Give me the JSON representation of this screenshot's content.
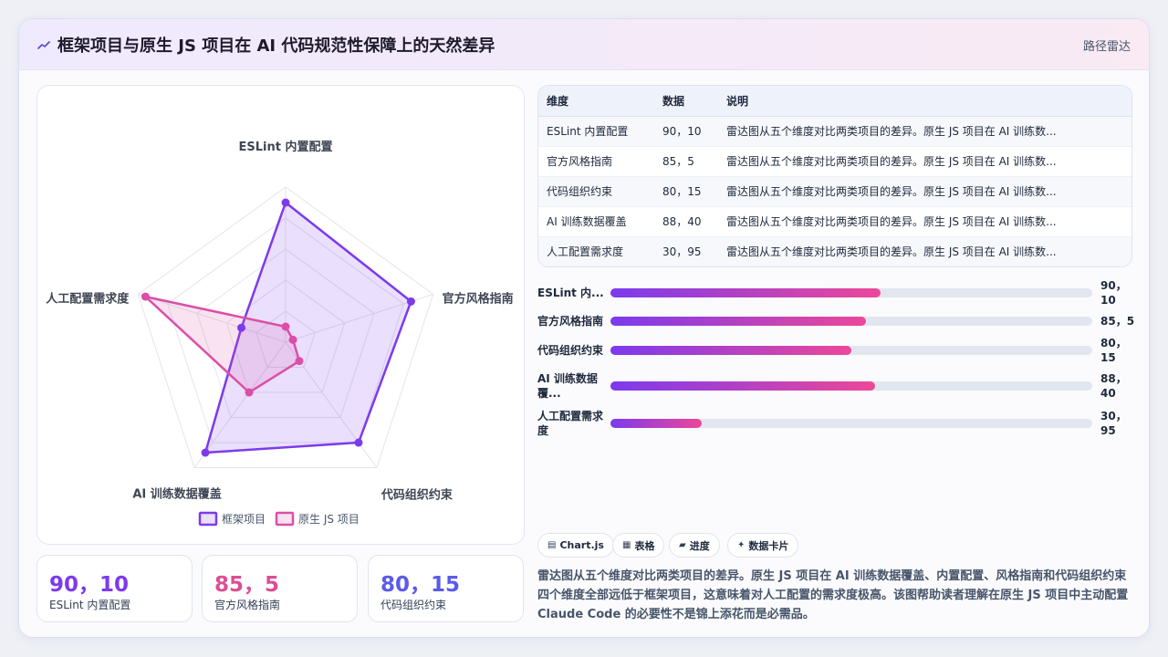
{
  "header": {
    "icon": "chart-line-icon",
    "title": "框架项目与原生 JS 项目在 AI 代码规范性保障上的天然差异",
    "right_label": "路径雷达"
  },
  "colors": {
    "framework": "#7c3aed",
    "native": "#db4fa7",
    "kpi1": "#7c3aed",
    "kpi2": "#db4f94",
    "kpi3": "#5b5be8"
  },
  "chart_data": {
    "type": "radar",
    "axes": [
      "ESLint 内置配置",
      "官方风格指南",
      "代码组织约束",
      "AI 训练数据覆盖",
      "人工配置需求度"
    ],
    "series": [
      {
        "name": "框架项目",
        "values": [
          90,
          85,
          80,
          88,
          30
        ]
      },
      {
        "name": "原生 JS 项目",
        "values": [
          10,
          5,
          15,
          40,
          95
        ]
      }
    ],
    "range": [
      0,
      100
    ],
    "grid_levels": 5,
    "legend_position": "bottom"
  },
  "legend": [
    {
      "label": "框架项目"
    },
    {
      "label": "原生 JS 项目"
    }
  ],
  "kpis": [
    {
      "value": "90，10",
      "label": "ESLint 内置配置"
    },
    {
      "value": "85，5",
      "label": "官方风格指南"
    },
    {
      "value": "80，15",
      "label": "代码组织约束"
    }
  ],
  "table": {
    "headers": [
      "维度",
      "数据",
      "说明"
    ],
    "rows": [
      {
        "dim": "ESLint 内置配置",
        "data": "90，10",
        "desc": "雷达图从五个维度对比两类项目的差异。原生 JS 项目在 AI 训练数..."
      },
      {
        "dim": "官方风格指南",
        "data": "85，5",
        "desc": "雷达图从五个维度对比两类项目的差异。原生 JS 项目在 AI 训练数..."
      },
      {
        "dim": "代码组织约束",
        "data": "80，15",
        "desc": "雷达图从五个维度对比两类项目的差异。原生 JS 项目在 AI 训练数..."
      },
      {
        "dim": "AI 训练数据覆盖",
        "data": "88，40",
        "desc": "雷达图从五个维度对比两类项目的差异。原生 JS 项目在 AI 训练数..."
      },
      {
        "dim": "人工配置需求度",
        "data": "30，95",
        "desc": "雷达图从五个维度对比两类项目的差异。原生 JS 项目在 AI 训练数..."
      }
    ]
  },
  "bars": [
    {
      "label": "ESLint 内...",
      "value": "90，10",
      "fill_fraction": 0.56
    },
    {
      "label": "官方风格指南",
      "value": "85，5",
      "fill_fraction": 0.53
    },
    {
      "label": "代码组织约束",
      "value": "80，15",
      "fill_fraction": 0.5
    },
    {
      "label": "AI 训练数据覆...",
      "value": "88，40",
      "fill_fraction": 0.55
    },
    {
      "label": "人工配置需求度",
      "value": "30，95",
      "fill_fraction": 0.19
    }
  ],
  "tags": [
    {
      "icon": "chart-icon",
      "label": "Chart.js"
    },
    {
      "icon": "table-icon",
      "label": "表格"
    },
    {
      "icon": "progress-icon",
      "label": "进度"
    },
    {
      "icon": "sparkle-icon",
      "label": "数据卡片"
    }
  ],
  "description": "雷达图从五个维度对比两类项目的差异。原生 JS 项目在 AI 训练数据覆盖、内置配置、风格指南和代码组织约束四个维度全部远低于框架项目，这意味着对人工配置的需求度极高。该图帮助读者理解在原生 JS 项目中主动配置 Claude Code 的必要性不是锦上添花而是必需品。"
}
